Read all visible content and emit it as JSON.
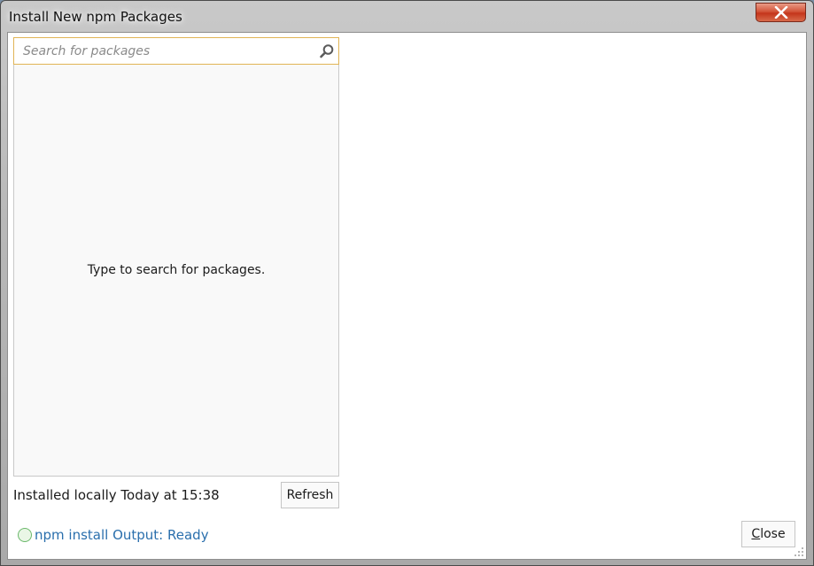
{
  "window": {
    "title": "Install New npm Packages"
  },
  "search": {
    "placeholder": "Search for packages",
    "value": ""
  },
  "results": {
    "empty_message": "Type to search for packages."
  },
  "footer": {
    "installed_label": "Installed locally Today at 15:38",
    "refresh_label": "Refresh",
    "status_link": "npm install Output: Ready",
    "close_prefix": "C",
    "close_rest": "lose"
  },
  "colors": {
    "search_border": "#e1b455",
    "link": "#2a6fad",
    "status_ring": "#6bb86b",
    "close_red": "#c4351b"
  },
  "icons": [
    "close-icon",
    "search-icon",
    "status-ring-icon",
    "resize-grip-icon"
  ]
}
